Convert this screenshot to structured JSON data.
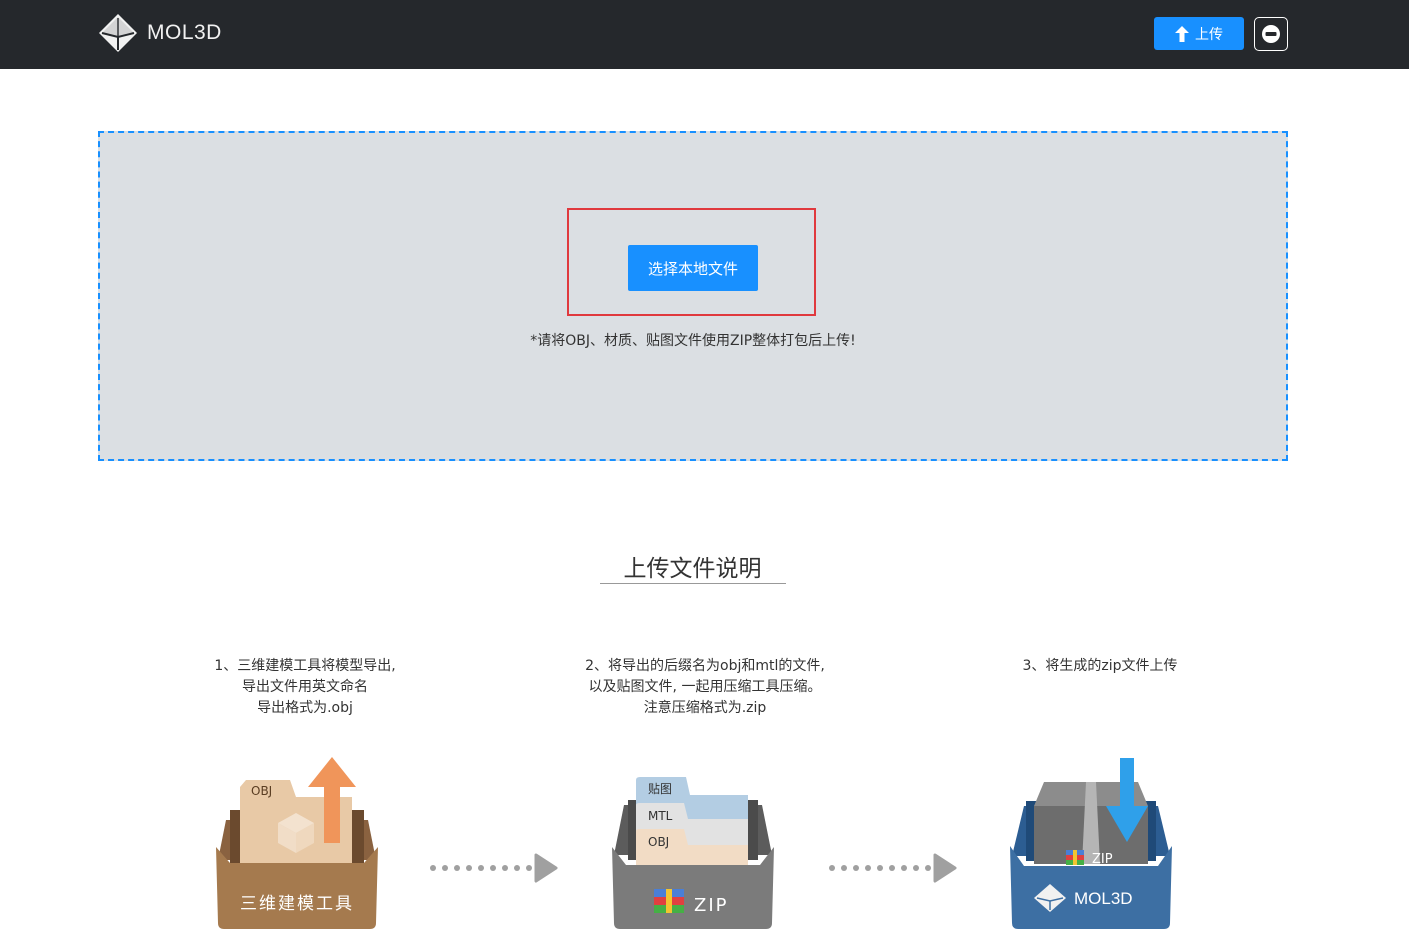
{
  "header": {
    "brand": "MOL3D",
    "upload_label": "上传"
  },
  "upload": {
    "choose_label": "选择本地文件",
    "hint": "*请将OBJ、材质、贴图文件使用ZIP整体打包后上传!"
  },
  "instructions": {
    "title": "上传文件说明",
    "steps": [
      {
        "lines": [
          "1、三维建模工具将模型导出,",
          "导出文件用英文命名",
          "导出格式为.obj"
        ]
      },
      {
        "lines": [
          "2、将导出的后缀名为obj和mtl的文件,",
          "以及贴图文件, 一起用压缩工具压缩。",
          "注意压缩格式为.zip"
        ]
      },
      {
        "lines": [
          "3、将生成的zip文件上传"
        ]
      }
    ]
  },
  "illustrations": {
    "tool": {
      "folder_tag": "OBJ",
      "box_label": "三维建模工具"
    },
    "zip": {
      "tags": [
        "贴图",
        "MTL",
        "OBJ"
      ],
      "box_label": "ZIP"
    },
    "mol3d": {
      "package_label": "ZIP",
      "box_label": "MOL3D"
    }
  },
  "colors": {
    "header_bg": "#25282c",
    "accent": "#1890ff",
    "highlight": "#e0393e",
    "dropzone_bg": "#dbdfe3"
  }
}
